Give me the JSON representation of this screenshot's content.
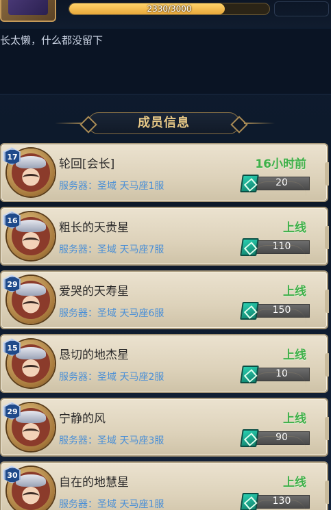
{
  "header": {
    "exp_text": "2330/3000",
    "exp_progress": 0.7767
  },
  "notice": {
    "text": "长太懒，什么都没留下"
  },
  "section": {
    "title": "成员信息"
  },
  "members": [
    {
      "level": "17",
      "name": "轮回[会长]",
      "server": "服务器：圣域 天马座1服",
      "status": "16小时前",
      "contribution": "20"
    },
    {
      "level": "16",
      "name": "粗长的天贵星",
      "server": "服务器：圣域 天马座7服",
      "status": "上线",
      "contribution": "110"
    },
    {
      "level": "29",
      "name": "爱哭的天寿星",
      "server": "服务器：圣域 天马座6服",
      "status": "上线",
      "contribution": "150"
    },
    {
      "level": "15",
      "name": "恳切的地杰星",
      "server": "服务器：圣域 天马座2服",
      "status": "上线",
      "contribution": "10"
    },
    {
      "level": "29",
      "name": "宁静的风",
      "server": "服务器：圣域 天马座3服",
      "status": "上线",
      "contribution": "90"
    },
    {
      "level": "30",
      "name": "自在的地慧星",
      "server": "服务器：圣域 天马座1服",
      "status": "上线",
      "contribution": "130"
    }
  ],
  "colors": {
    "status_online": "#3fb04a",
    "server_text": "#4a8fd6",
    "section_title": "#e8c987"
  }
}
